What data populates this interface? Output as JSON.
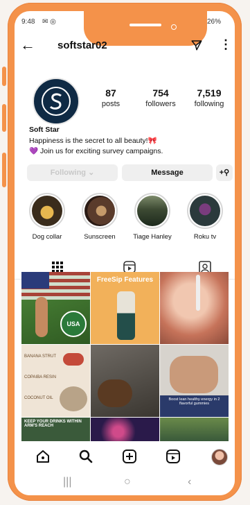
{
  "status_bar": {
    "time": "9:48",
    "battery": "26%"
  },
  "profile": {
    "username": "softstar02",
    "stats": [
      {
        "value": "87",
        "label": "posts"
      },
      {
        "value": "754",
        "label": "followers"
      },
      {
        "value": "7,519",
        "label": "following"
      }
    ],
    "display_name": "Soft Star",
    "bio_line1": "Happiness is the secret to all beauty!🎀",
    "bio_line2": "💜 Join us for exciting survey campaigns."
  },
  "buttons": {
    "following": "Following ⌄",
    "message": "Message"
  },
  "highlights": [
    {
      "label": "Dog collar"
    },
    {
      "label": "Sunscreen"
    },
    {
      "label": "Tiage Hanley"
    },
    {
      "label": "Roku tv"
    }
  ],
  "posts": {
    "p2_title": "FreeSip Features",
    "p6_caption": "Boost lean healthy energy in 2 flavorful gummies",
    "p7_caption": "KEEP YOUR DRINKS WITHIN ARM'S REACH",
    "p1_badge": "USA",
    "p4_labels": [
      "BANANA STRUT",
      "COPAIBA RESIN",
      "COCONUT OIL"
    ]
  },
  "colors": {
    "frame": "#f4924a",
    "avatar_bg": "#0f2a44",
    "accent": "#111111"
  }
}
